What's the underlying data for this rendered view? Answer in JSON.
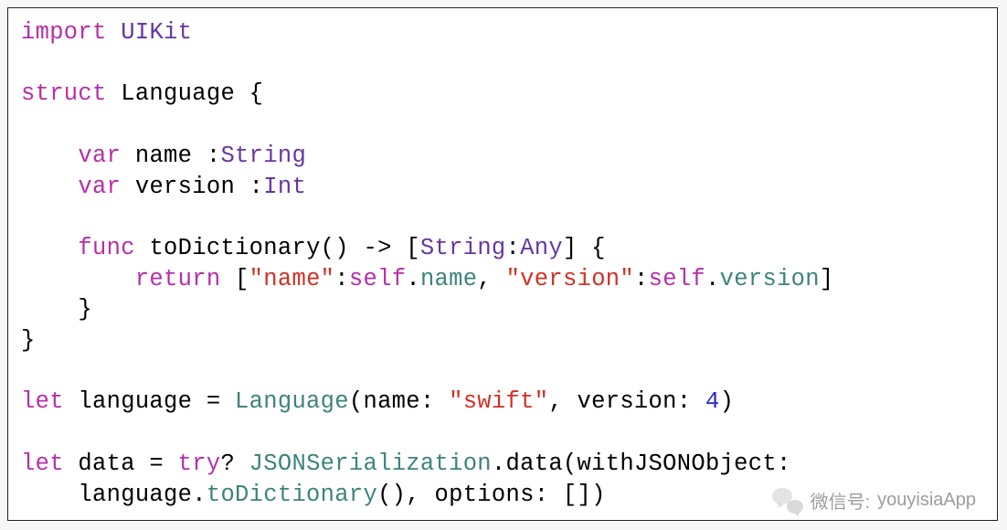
{
  "code": {
    "line1": {
      "kw_import": "import",
      "sp": " ",
      "type_uikit": "UIKit"
    },
    "line3": {
      "kw_struct": "struct",
      "name": " Language {"
    },
    "line5": {
      "indent": "    ",
      "kw_var": "var",
      "decl": " name :",
      "type": "String"
    },
    "line6": {
      "indent": "    ",
      "kw_var": "var",
      "decl": " version :",
      "type": "Int"
    },
    "line8": {
      "indent": "    ",
      "kw_func": "func",
      "sig1": " toDictionary() -> [",
      "t_string": "String",
      "colon": ":",
      "t_any": "Any",
      "sig2": "] {"
    },
    "line9": {
      "indent": "        ",
      "kw_return": "return",
      "sp": " [",
      "s_name": "\"name\"",
      "c1": ":",
      "kw_self1": "self",
      "dot1": ".",
      "p_name": "name",
      "comma": ", ",
      "s_version": "\"version\"",
      "c2": ":",
      "kw_self2": "self",
      "dot2": ".",
      "p_version": "version",
      "close": "]"
    },
    "line10": {
      "text": "    }"
    },
    "line11": {
      "text": "}"
    },
    "line13": {
      "kw_let": "let",
      "decl": " language = ",
      "type_lang": "Language",
      "open": "(name: ",
      "s_swift": "\"swift\"",
      "mid": ", version: ",
      "num4": "4",
      "close": ")"
    },
    "line15": {
      "kw_let": "let",
      "decl": " data = ",
      "kw_try": "try",
      "q": "? ",
      "type_json": "JSONSerialization",
      "call": ".data(withJSONObject:"
    },
    "line16": {
      "indent": "    language.",
      "method": "toDictionary",
      "rest": "(), options: [])"
    }
  },
  "watermark": {
    "label": "微信号:",
    "id": "youyisiaApp"
  }
}
